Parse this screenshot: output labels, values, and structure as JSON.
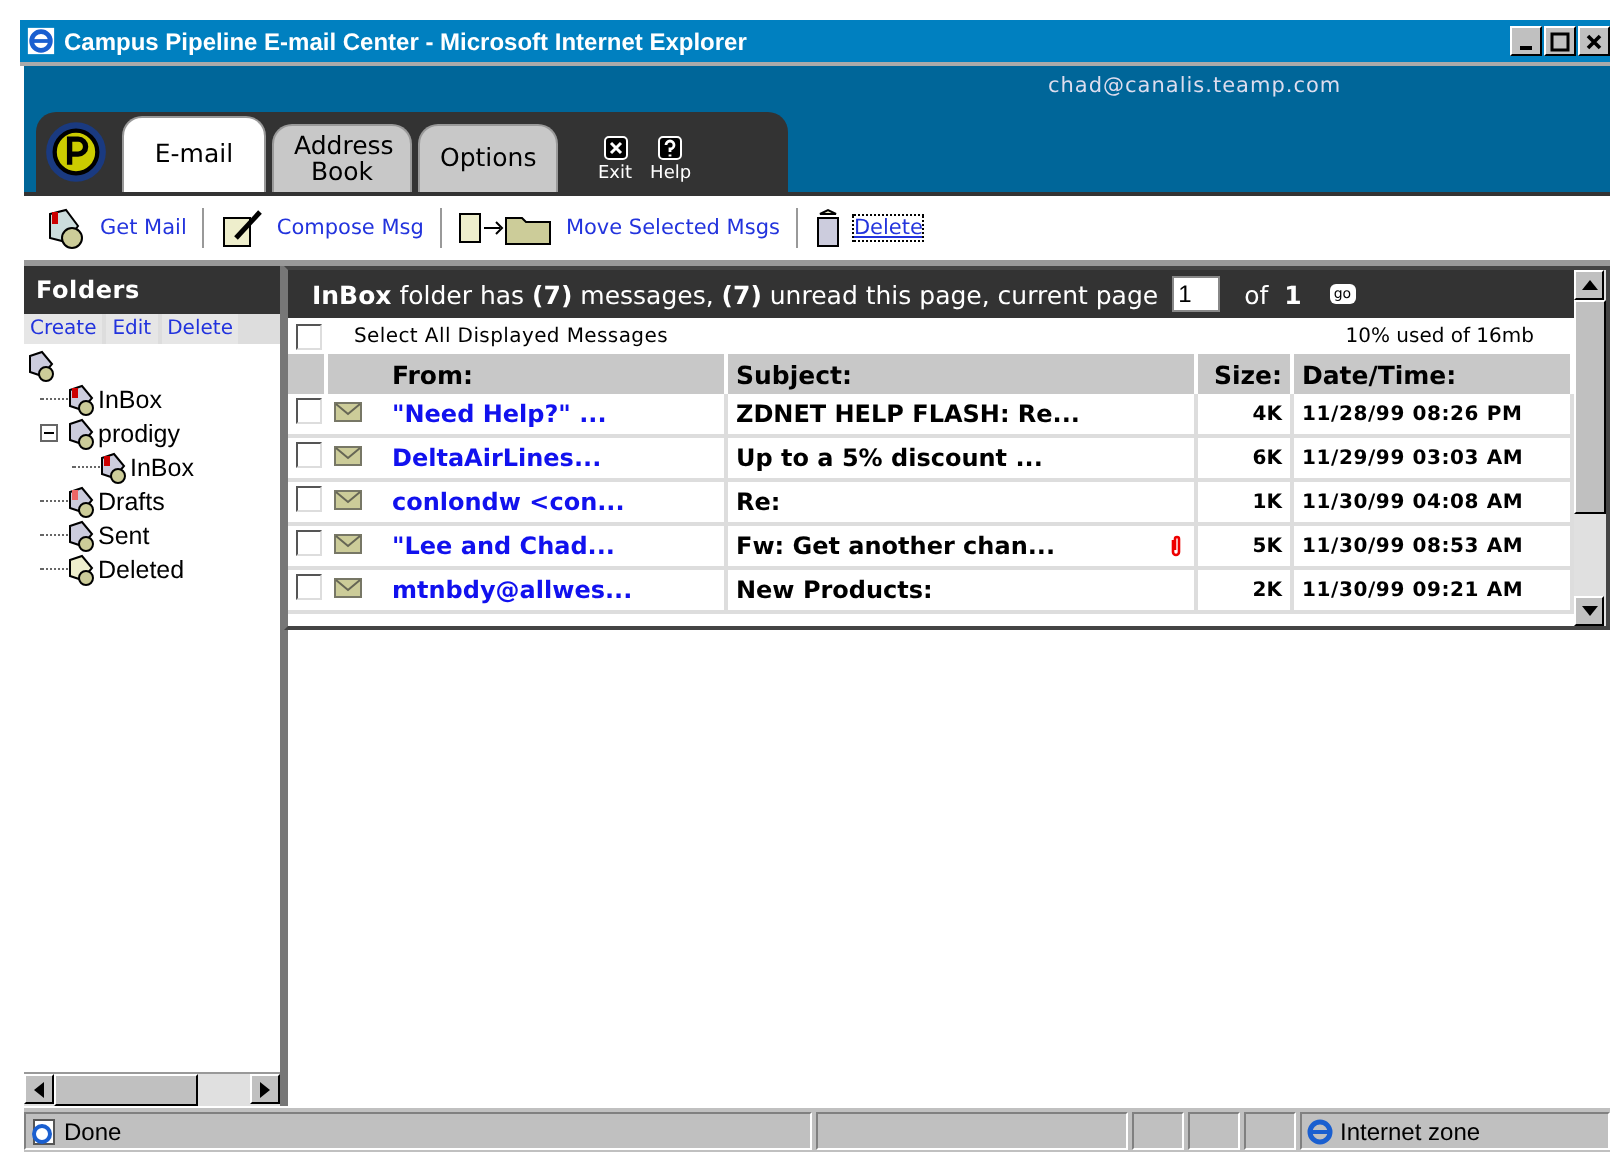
{
  "window": {
    "title": "Campus Pipeline E-mail Center - Microsoft Internet Explorer"
  },
  "account": "chad@canalis.teamp.com",
  "tabs": [
    {
      "label": "E-mail",
      "selected": true
    },
    {
      "label": "Address Book",
      "selected": false
    },
    {
      "label": "Options",
      "selected": false
    }
  ],
  "tab_actions": [
    {
      "label": "Exit",
      "kind": "exit"
    },
    {
      "label": "Help",
      "kind": "help"
    }
  ],
  "toolbar": [
    {
      "label": "Get Mail",
      "kind": "get"
    },
    {
      "label": "Compose Msg",
      "kind": "compose"
    },
    {
      "label": "Move Selected Msgs",
      "kind": "move"
    },
    {
      "label": "Delete",
      "kind": "delete"
    }
  ],
  "folders": {
    "title": "Folders",
    "actions": [
      "Create",
      "Edit",
      "Delete"
    ],
    "tree": [
      {
        "label": "InBox",
        "kind": "inbox"
      },
      {
        "label": "prodigy",
        "kind": "account",
        "expanded": true,
        "children": [
          {
            "label": "InBox",
            "kind": "inbox"
          }
        ]
      },
      {
        "label": "Drafts",
        "kind": "drafts"
      },
      {
        "label": "Sent",
        "kind": "sent"
      },
      {
        "label": "Deleted",
        "kind": "trash"
      }
    ]
  },
  "summary": "**InBox** folder has **(7)** messages, **(7)** unread this page, current page",
  "page": {
    "value": "1",
    "of": "of",
    "total": "1",
    "go": "go"
  },
  "select_all": {
    "label": "Select All Displayed Messages",
    "checked": false
  },
  "quota": "10% used of 16mb",
  "columns": [
    "From:",
    "Subject:",
    "Size:",
    "Date/Time:"
  ],
  "rows": [
    {
      "checked": false,
      "from": "\"Need Help?\" ...",
      "subject": "ZDNET HELP FLASH: Re...",
      "attachment": false,
      "size": "4K",
      "date": "11/28/99 08:26 PM"
    },
    {
      "checked": false,
      "from": "DeltaAirLines...",
      "subject": "Up to a 5% discount ...",
      "attachment": false,
      "size": "6K",
      "date": "11/29/99 03:03 AM"
    },
    {
      "checked": false,
      "from": "conlondw <con...",
      "subject": "Re:",
      "attachment": false,
      "size": "1K",
      "date": "11/30/99 04:08 AM"
    },
    {
      "checked": false,
      "from": "\"Lee and Chad...",
      "subject": "Fw: Get another chan...",
      "attachment": true,
      "size": "5K",
      "date": "11/30/99 08:53 AM"
    },
    {
      "checked": false,
      "from": "mtnbdy@allwes...",
      "subject": "New Products:",
      "attachment": false,
      "size": "2K",
      "date": "11/30/99 09:21 AM"
    }
  ],
  "status_bar": {
    "text": "Done",
    "zone": "Internet zone"
  }
}
